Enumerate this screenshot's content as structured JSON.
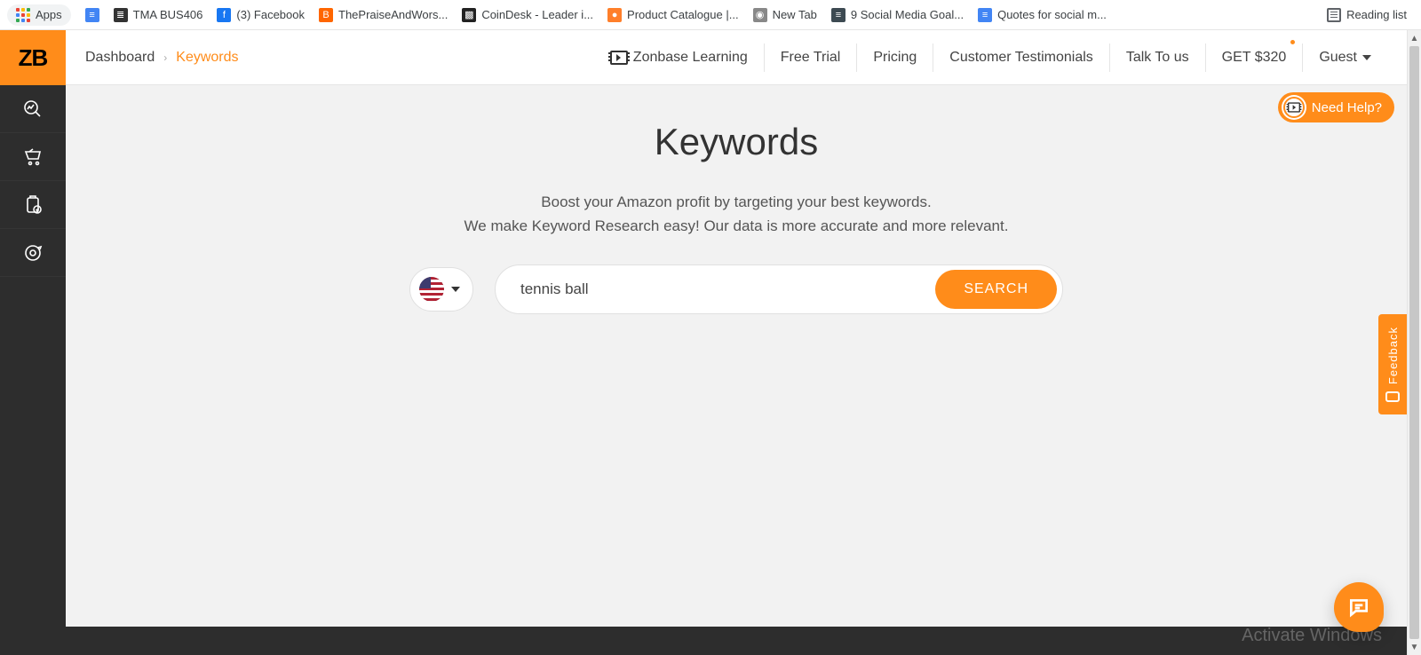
{
  "bookmarks": {
    "apps_label": "Apps",
    "items": [
      {
        "label": "",
        "icon_bg": "#4285f4",
        "icon_text": "≡"
      },
      {
        "label": "TMA BUS406",
        "icon_bg": "#333",
        "icon_text": "≣"
      },
      {
        "label": "(3) Facebook",
        "icon_bg": "#1877f2",
        "icon_text": "f"
      },
      {
        "label": "ThePraiseAndWors...",
        "icon_bg": "#ff6600",
        "icon_text": "B"
      },
      {
        "label": "CoinDesk - Leader i...",
        "icon_bg": "#222",
        "icon_text": "▩"
      },
      {
        "label": "Product Catalogue |...",
        "icon_bg": "#ff7f2a",
        "icon_text": "●"
      },
      {
        "label": "New Tab",
        "icon_bg": "#888",
        "icon_text": "◉"
      },
      {
        "label": "9 Social Media Goal...",
        "icon_bg": "#3d4a52",
        "icon_text": "≡"
      },
      {
        "label": "Quotes for social m...",
        "icon_bg": "#4285f4",
        "icon_text": "≡"
      }
    ],
    "reading_list": "Reading list"
  },
  "logo_text": "ZB",
  "sidebar_icons": [
    "search-trend",
    "cart",
    "clipboard-check",
    "target-refresh"
  ],
  "breadcrumb": {
    "root": "Dashboard",
    "current": "Keywords"
  },
  "header": {
    "learning": "Zonbase Learning",
    "free_trial": "Free Trial",
    "pricing": "Pricing",
    "testimonials": "Customer Testimonials",
    "talk": "Talk To us",
    "get320": "GET $320",
    "guest": "Guest"
  },
  "page": {
    "title": "Keywords",
    "subtitle_line1": "Boost your Amazon profit by targeting your best keywords.",
    "subtitle_line2": "We make Keyword Research easy! Our data is more accurate and more relevant.",
    "search_value": "tennis ball",
    "search_button": "SEARCH"
  },
  "need_help": "Need Help?",
  "feedback": "Feedback",
  "watermark": "Activate Windows",
  "apps_dot_colors": [
    "#ea4335",
    "#fbbc05",
    "#34a853",
    "#4285f4",
    "#ea4335",
    "#fbbc05",
    "#34a853",
    "#4285f4",
    "#ea4335"
  ]
}
